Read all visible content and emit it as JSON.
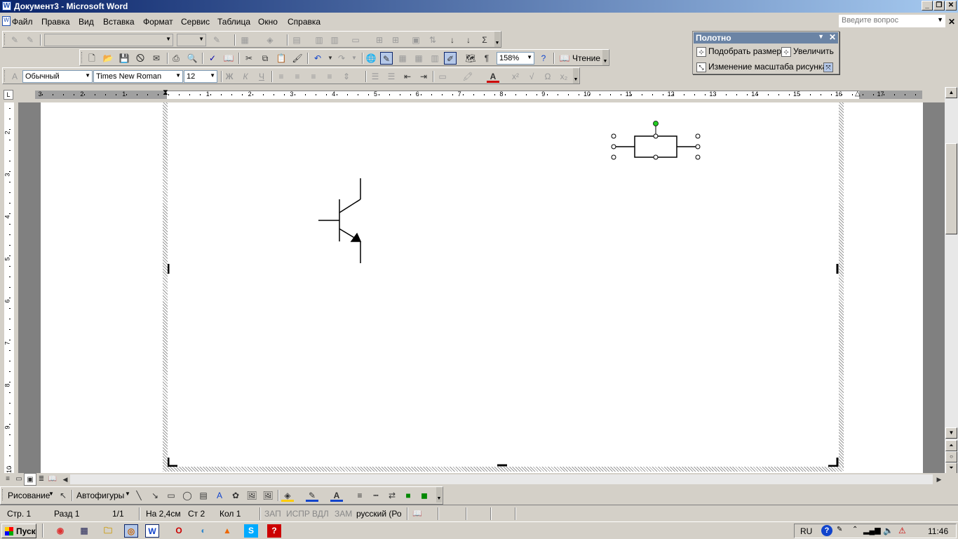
{
  "window": {
    "title": "Документ3 - Microsoft Word"
  },
  "menu": {
    "items": [
      "Файл",
      "Правка",
      "Вид",
      "Вставка",
      "Формат",
      "Сервис",
      "Таблица",
      "Окно",
      "Справка"
    ],
    "help_placeholder": "Введите вопрос"
  },
  "toolbar_standard": {
    "zoom": "158%",
    "reading": "Чтение"
  },
  "toolbar_format": {
    "style": "Обычный",
    "font": "Times New Roman",
    "size": "12"
  },
  "canvas_panel": {
    "title": "Полотно",
    "fit": "Подобрать размер",
    "expand": "Увеличить",
    "scale": "Изменение масштаба рисунка"
  },
  "ruler": {
    "h_numbers": [
      "3",
      "2",
      "1",
      "1",
      "2",
      "3",
      "4",
      "5",
      "6",
      "7",
      "8",
      "9",
      "10",
      "11",
      "12",
      "13",
      "14",
      "15",
      "16",
      "17"
    ],
    "v_numbers": [
      "2",
      "3",
      "4",
      "5",
      "6",
      "7",
      "8",
      "9",
      "10"
    ]
  },
  "drawing_toolbar": {
    "drawing": "Рисование",
    "autoshapes": "Автофигуры"
  },
  "status": {
    "page": "Стр. 1",
    "section": "Разд 1",
    "pages": "1/1",
    "at": "На 2,4см",
    "line": "Ст 2",
    "col": "Кол 1",
    "rec": "ЗАП",
    "trk": "ИСПР",
    "ext": "ВДЛ",
    "ovr": "ЗАМ",
    "lang": "русский (Ро"
  },
  "taskbar": {
    "start": "Пуск",
    "lang": "RU",
    "time": "11:46"
  }
}
